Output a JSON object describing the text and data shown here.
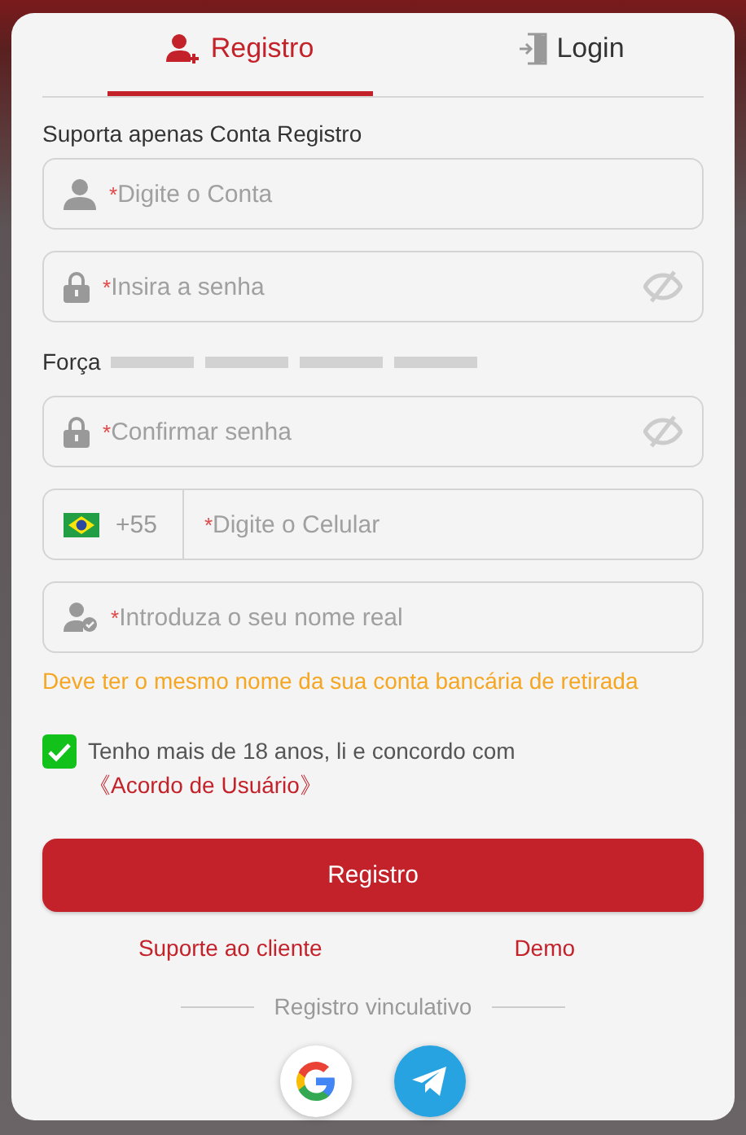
{
  "tabs": [
    {
      "kind": "register",
      "label": "Registro",
      "selected": true
    },
    {
      "kind": "login",
      "label": "Login",
      "selected": false
    }
  ],
  "notice": "Suporta apenas Conta Registro",
  "fields": [
    {
      "kind": "account",
      "mark": "*",
      "placeholder": "Digite o Conta"
    },
    {
      "kind": "password",
      "mark": "*",
      "placeholder": "Insira a senha"
    },
    {
      "kind": "strength",
      "label": "Força",
      "level": 0
    },
    {
      "kind": "password",
      "mark": "*",
      "placeholder": "Confirmar senha"
    },
    {
      "kind": "phone",
      "code": "+55",
      "mark": "*",
      "placeholder": "Digite o Celular"
    },
    {
      "kind": "realname",
      "mark": "*",
      "placeholder": "Introduza o seu nome real"
    }
  ],
  "name_hint": "Deve ter o mesmo nome da sua conta bancária de retirada",
  "agreement": {
    "checked": true,
    "text": "Tenho mais de 18 anos, li e concordo com",
    "link": "《Acordo de Usuário》"
  },
  "submit": "Registro",
  "links": [
    "Suporte ao cliente",
    "Demo"
  ],
  "social": {
    "title": "Registro vinculativo",
    "providers": [
      {
        "kind": "google"
      },
      {
        "kind": "telegram"
      }
    ]
  }
}
